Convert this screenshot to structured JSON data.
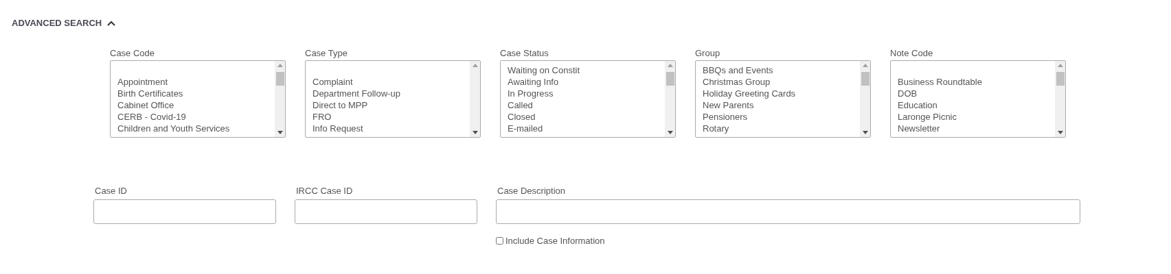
{
  "header": {
    "title": "ADVANCED SEARCH",
    "expanded": true
  },
  "listboxes": [
    {
      "label": "Case Code",
      "blank_option": true,
      "options": [
        "Appointment",
        "Birth Certificates",
        "Cabinet Office",
        "CERB - Covid-19",
        "Children and Youth Services"
      ]
    },
    {
      "label": "Case Type",
      "blank_option": true,
      "options": [
        "Complaint",
        "Department Follow-up",
        "Direct to MPP",
        "FRO",
        "Info Request"
      ]
    },
    {
      "label": "Case Status",
      "blank_option": false,
      "options": [
        "Waiting on Constit",
        "Awaiting Info",
        "In Progress",
        "Called",
        "Closed",
        "E-mailed"
      ]
    },
    {
      "label": "Group",
      "blank_option": false,
      "options": [
        "BBQs and Events",
        "Christmas Group",
        "Holiday Greeting Cards",
        "New Parents",
        "Pensioners",
        "Rotary"
      ]
    },
    {
      "label": "Note Code",
      "blank_option": true,
      "options": [
        "Business Roundtable",
        "DOB",
        "Education",
        "Laronge Picnic",
        "Newsletter"
      ]
    }
  ],
  "fields": [
    {
      "label": "Case ID",
      "wide": false
    },
    {
      "label": "IRCC Case ID",
      "wide": false
    },
    {
      "label": "Case Description",
      "wide": true
    }
  ],
  "checkbox": {
    "label": "Include Case Information",
    "checked": false
  }
}
